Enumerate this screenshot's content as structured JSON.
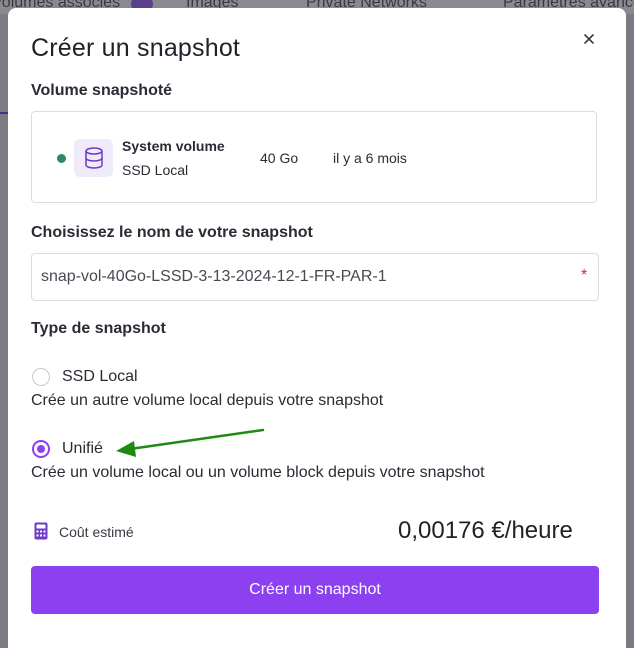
{
  "background": {
    "tabs": [
      "Volumes associés",
      "Images",
      "Private Networks",
      "Paramètres avancés"
    ]
  },
  "modal": {
    "title": "Créer un snapshot",
    "close_icon": "close-icon",
    "volume_section": {
      "label": "Volume snapshoté",
      "volume": {
        "status_color": "#2b8a61",
        "icon": "database-icon",
        "name": "System volume",
        "type": "SSD Local",
        "size": "40 Go",
        "age": "il y a 6 mois"
      }
    },
    "name_section": {
      "label": "Choisissez le nom de votre snapshot",
      "value": "snap-vol-40Go-LSSD-3-13-2024-12-1-FR-PAR-1",
      "required_mark": "*"
    },
    "type_section": {
      "label": "Type de snapshot",
      "options": [
        {
          "label": "SSD Local",
          "description": "Crée un autre volume local depuis votre snapshot",
          "selected": false
        },
        {
          "label": "Unifié",
          "description": "Crée un volume local ou un volume block depuis votre snapshot",
          "selected": true
        }
      ]
    },
    "cost": {
      "icon": "calculator-icon",
      "label": "Coût estimé",
      "value": "0,00176 €/heure"
    },
    "submit_label": "Créer un snapshot"
  },
  "colors": {
    "accent": "#8c40ef",
    "annotation_arrow": "#1f8a12",
    "status_ok": "#2b8a61"
  }
}
